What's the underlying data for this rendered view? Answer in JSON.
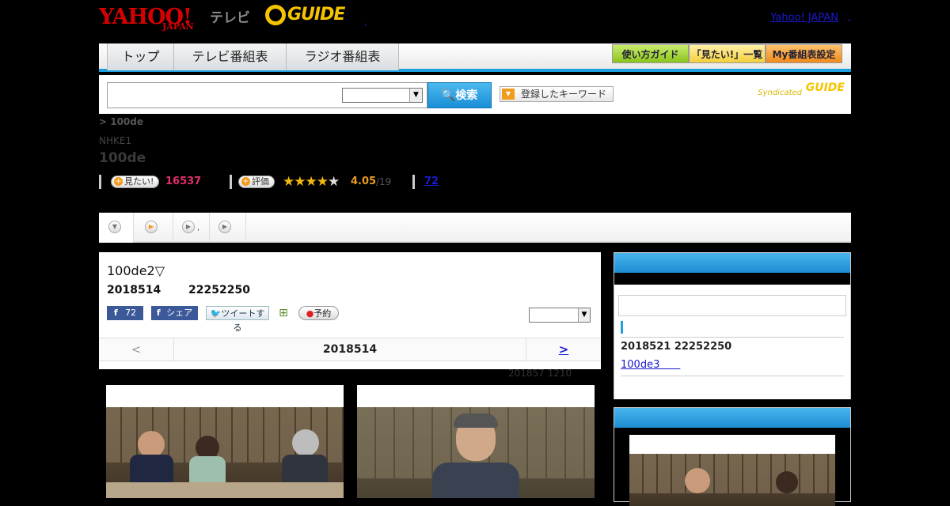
{
  "header": {
    "logo_yahoo": "YAHOO!",
    "logo_japan": "JAPAN",
    "logo_tv": "テレビ",
    "logo_gguide": "GUIDE",
    "dot": ",",
    "yahoo_japan_link": "Yahoo! JAPAN",
    "comma": ","
  },
  "nav": {
    "tabs": [
      "トップ",
      "テレビ番組表",
      "ラジオ番組表"
    ],
    "buttons": [
      "使い方ガイド",
      "「見たい!」一覧",
      "My番組表設定"
    ]
  },
  "search": {
    "input_value": "",
    "select_value": "",
    "button_label": "検索",
    "keyword_button_label": "登録したキーワード",
    "syndicated_label": "Syndicated",
    "syndicated_logo": "GUIDE"
  },
  "program": {
    "breadcrumb": " > 100de",
    "channel": "NHKE1",
    "title": "100de",
    "want_label": "見たい!",
    "want_count": "16537",
    "rate_label": "評価",
    "stars": "★★★★",
    "star_empty": "★",
    "rating": "4.05",
    "rating_sub": "/19",
    "review_count": "72"
  },
  "tabs": [
    {
      "label": ""
    },
    {
      "label": ","
    },
    {
      "label": ""
    },
    {
      "label": ""
    }
  ],
  "episode": {
    "title": "100de2▽",
    "date": "2018514",
    "time": "22252250",
    "fb_count": "72",
    "share_label": "シェア",
    "tweet_label": "ツイートする",
    "reserve_label": "予約",
    "select_value": "",
    "pager_prev": "<",
    "pager_current": "2018514",
    "pager_next": ">",
    "updated": "201857  1210"
  },
  "sidebar": {
    "header1": "",
    "search_value": "",
    "next_date": "2018521  22252250",
    "next_link": "100de3　　",
    "header2": ""
  }
}
